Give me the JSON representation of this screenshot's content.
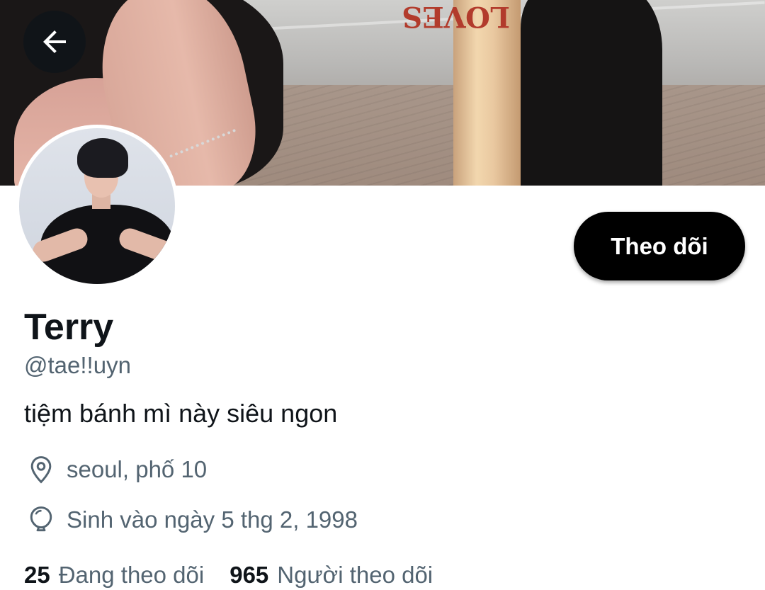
{
  "banner": {
    "bat_text": "LOVES"
  },
  "profile": {
    "display_name": "Terry",
    "handle": "@tae!!uyn",
    "bio": "tiệm bánh mì này siêu ngon",
    "location": "seoul, phố 10",
    "birthday": "Sinh vào ngày 5 thg 2, 1998"
  },
  "actions": {
    "follow_label": "Theo dõi"
  },
  "stats": {
    "following_count": "25",
    "following_label": "Đang theo dõi",
    "followers_count": "965",
    "followers_label": "Người theo dõi"
  },
  "colors": {
    "primary_text": "#0f1419",
    "secondary_text": "#536471",
    "button_bg": "#000000",
    "button_text": "#ffffff"
  },
  "icons": {
    "back": "arrow-left-icon",
    "location": "location-pin-icon",
    "birthday": "balloon-icon"
  }
}
